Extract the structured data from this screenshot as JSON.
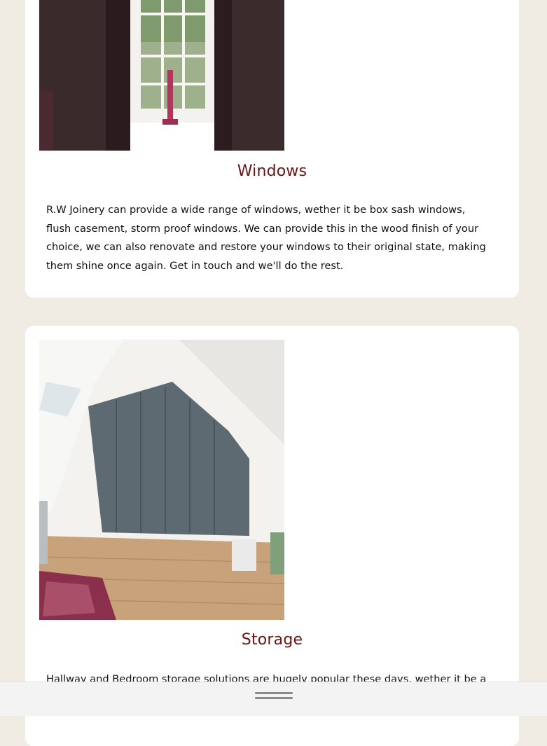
{
  "sections": [
    {
      "title": "Windows",
      "body": "R.W Joinery can provide a wide range of windows, wether it be box sash windows, flush casement, storm proof windows. We can provide this in the wood finish of your choice, we can also renovate and restore your windows to their original state, making them shine once again. Get in touch and we'll do the rest."
    },
    {
      "title": "Storage",
      "body": "Hallway and Bedroom storage solutions are hugely popular these days, wether it be a walk in"
    }
  ],
  "colors": {
    "background": "#f0ebe3",
    "card": "#ffffff",
    "heading": "#6b1414"
  },
  "icons": {
    "drag_handle": "drag-handle-icon"
  }
}
